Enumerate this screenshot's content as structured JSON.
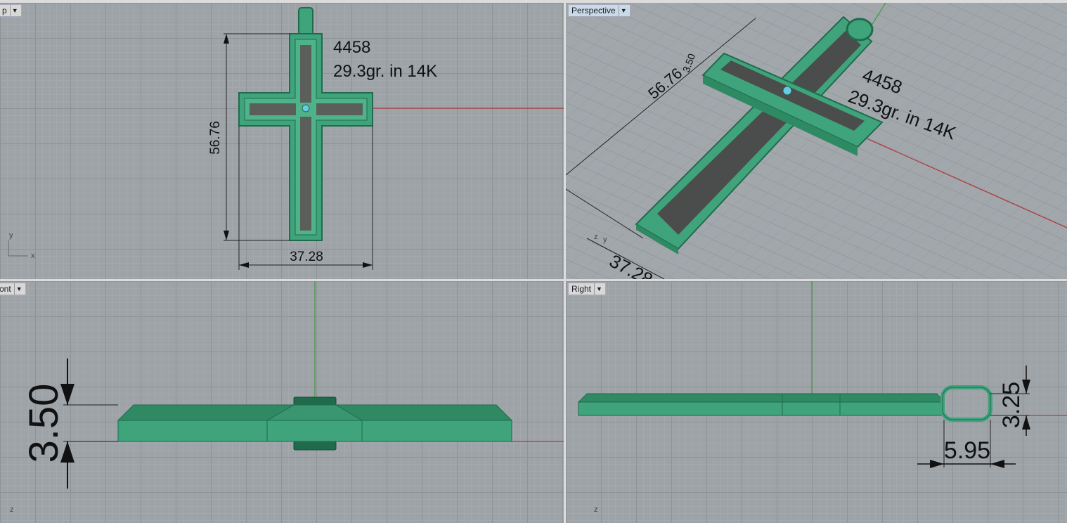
{
  "viewports": {
    "top": {
      "label": "p",
      "menu_icon": "chevron-down-icon"
    },
    "persp": {
      "label": "Perspective",
      "menu_icon": "chevron-down-icon"
    },
    "front": {
      "label": "ont",
      "menu_icon": "chevron-down-icon"
    },
    "right": {
      "label": "Right",
      "menu_icon": "chevron-down-icon"
    }
  },
  "annotations": {
    "model_id": "4458",
    "weight": "29.3gr. in 14K",
    "height": "56.76",
    "width": "37.28",
    "thickness": "3.50",
    "bail_height": "3.25",
    "bail_width": "5.95"
  },
  "axes": {
    "x": "x",
    "y": "y",
    "z": "z"
  },
  "colors": {
    "model": "#3fa37c",
    "model_dark": "#1f6b4c",
    "inlay": "#5b5f5b",
    "axis_red": "#b22",
    "axis_green": "#2a9a2a",
    "grid_bg": "#9ea3a8"
  }
}
